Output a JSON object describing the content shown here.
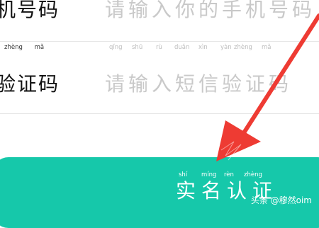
{
  "phone_row": {
    "label": "机号码",
    "placeholder": "请输入你的手机号码"
  },
  "code_row": {
    "label": "验证码",
    "label_pinyin": [
      "zhèng",
      "mǎ"
    ],
    "placeholder": "请输入短信验证码",
    "placeholder_pinyin": [
      "qǐng",
      "shū",
      "rù",
      "duǎn",
      "xìn",
      "yàn",
      "zhèng",
      "mǎ"
    ]
  },
  "submit": {
    "label": "实名认证",
    "pinyin": [
      "shí",
      "míng",
      "rèn",
      "zhèng"
    ]
  },
  "watermark": "头条 @穆然oim",
  "colors": {
    "accent": "#16c8aa",
    "arrow": "#ee3b33",
    "placeholder": "#c9c9c9"
  }
}
